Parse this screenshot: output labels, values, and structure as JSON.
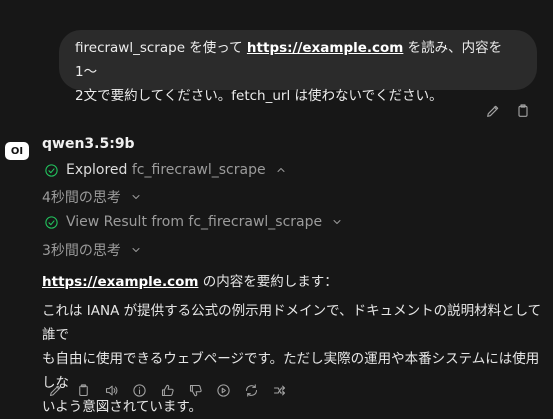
{
  "user_message": {
    "prefix": "firecrawl_scrape を使って ",
    "link": "https://example.com",
    "suffix_line1": " を読み、内容を1〜",
    "line2": "2文で要約してください。fetch_url は使わないでください。"
  },
  "assistant": {
    "avatar": "OI",
    "model": "qwen3.5:9b",
    "steps": [
      {
        "label": "Explored",
        "tool": " fc_firecrawl_scrape",
        "chevron": "up"
      },
      {
        "label": "4秒間の思考",
        "chevron": "down"
      },
      {
        "label": "View Result from fc_firecrawl_scrape",
        "chevron": "down"
      },
      {
        "label": "3秒間の思考",
        "chevron": "down"
      }
    ],
    "answer_link": "https://example.com",
    "answer_intro": " の内容を要約します：",
    "answer_body": [
      "これは IANA が提供する公式の例示用ドメインで、ドキュメントの説明材料として誰で",
      "も自由に使用できるウェブページです。ただし実際の運用や本番システムには使用しな",
      "いよう意図されています。"
    ]
  },
  "icons": {
    "user_actions": [
      "pencil-icon",
      "copy-icon"
    ],
    "message_actions": [
      "pencil-icon",
      "copy-icon",
      "speaker-icon",
      "info-icon",
      "thumbs-up-icon",
      "thumbs-down-icon",
      "play-icon",
      "regenerate-icon",
      "share-icon"
    ]
  },
  "colors": {
    "background": "#171717",
    "bubble": "#2b2b2b",
    "check": "#22c55e"
  }
}
